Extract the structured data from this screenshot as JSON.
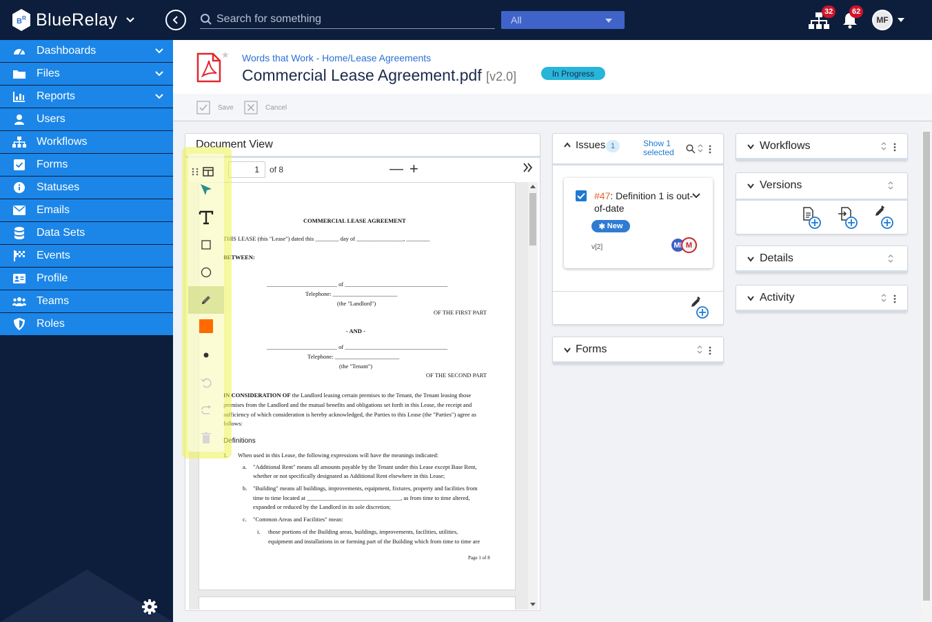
{
  "app": {
    "name": "BlueRelay"
  },
  "search": {
    "placeholder": "Search for something",
    "scope": "All"
  },
  "notifications": {
    "org_count": "32",
    "bell_count": "62"
  },
  "user": {
    "initials": "MF"
  },
  "sidebar": {
    "items": [
      {
        "label": "Dashboards",
        "icon": "dashboard-icon",
        "expandable": true
      },
      {
        "label": "Files",
        "icon": "folder-icon",
        "expandable": true
      },
      {
        "label": "Reports",
        "icon": "chart-icon",
        "expandable": true
      },
      {
        "label": "Users",
        "icon": "user-icon",
        "expandable": false
      },
      {
        "label": "Workflows",
        "icon": "sitemap-icon",
        "expandable": false
      },
      {
        "label": "Forms",
        "icon": "checkbox-icon",
        "expandable": false
      },
      {
        "label": "Statuses",
        "icon": "info-icon",
        "expandable": false
      },
      {
        "label": "Emails",
        "icon": "envelope-icon",
        "expandable": false
      },
      {
        "label": "Data Sets",
        "icon": "database-icon",
        "expandable": false
      },
      {
        "label": "Events",
        "icon": "flag-icon",
        "expandable": false
      },
      {
        "label": "Profile",
        "icon": "id-card-icon",
        "expandable": false
      },
      {
        "label": "Teams",
        "icon": "users-icon",
        "expandable": false
      },
      {
        "label": "Roles",
        "icon": "shield-icon",
        "expandable": false
      }
    ]
  },
  "header": {
    "breadcrumb": "Words that Work - Home/Lease Agreements",
    "title": "Commercial Lease Agreement.pdf",
    "version": "[v2.0]",
    "status": "In Progress"
  },
  "toolbar": {
    "save_label": "Save",
    "cancel_label": "Cancel"
  },
  "document_view": {
    "title": "Document View",
    "page": "1",
    "page_of": "of 8",
    "content": {
      "heading": "COMMERCIAL LEASE AGREEMENT",
      "l1": "THIS LEASE (this \"Lease\") dated this ________ day of ________________, ________",
      "between": "BETWEEN:",
      "l_of1": "________________________ of ___________________________________",
      "l_tel1": "Telephone: ______________________",
      "l_landlord": "(the \"Landlord\")",
      "l_first": "OF THE FIRST PART",
      "l_and": "- AND -",
      "l_of2": "________________________ of ___________________________________",
      "l_tel2": "Telephone: ______________________",
      "l_tenant": "(the \"Tenant\")",
      "l_second": "OF THE SECOND PART",
      "c_bold": "IN CONSIDERATION OF",
      "c1": " the Landlord leasing certain premises to the Tenant, the Tenant leasing those",
      "c2": "premises from the Landlord and the mutual benefits and obligations set forth in this Lease, the receipt and",
      "c3": "sufficiency of which consideration is hereby acknowledged, the Parties to this Lease (the \"Parties\") agree as",
      "c4": "follows:",
      "defs": "Definitions",
      "d1_num": "1.",
      "d1": "When used in this Lease, the following expressions will have the meanings indicated:",
      "da_num": "a.",
      "da1": "\"Additional Rent\" means all amounts payable by the Tenant under this Lease except Base Rent,",
      "da2": "whether or not specifically designated as Additional Rent elsewhere in this Lease;",
      "db_num": "b.",
      "db1": "\"Building\" means all buildings, improvements, equipment, fixtures, property and facilities from",
      "db2": "time to time located at ________________________________, as from time to time altered,",
      "db3": "expanded or reduced by the Landlord in its sole discretion;",
      "dc_num": "c.",
      "dc1": "\"Common Areas and Facilities\" mean:",
      "di_num": "i.",
      "di1": "those portions of the Building areas, buildings, improvements, facilities, utilities,",
      "di2": "equipment and installations in or forming part of the Building which from time to time are",
      "footer": "Page 1 of 8"
    }
  },
  "annotation_tools": [
    "grip-icon",
    "layout-icon",
    "pointer-icon",
    "text-icon",
    "rectangle-icon",
    "circle-icon",
    "pencil-icon",
    "color-swatch-icon",
    "dot-icon",
    "undo-icon",
    "redo-icon",
    "trash-icon"
  ],
  "colors": {
    "accent": "#1b86e8",
    "navy": "#0d1e3d",
    "swatch": "#ff6a00",
    "issue_number": "#e8602c"
  },
  "issues": {
    "title": "Issues",
    "count": "1",
    "show_selected": [
      "Show 1",
      "selected"
    ],
    "card": {
      "number": "#47",
      "title_rest": ": Definition 1 is out-of-date",
      "status": "New",
      "version": "v[2]",
      "avatars": [
        "MI",
        "M"
      ]
    }
  },
  "forms_panel": {
    "title": "Forms"
  },
  "right_panels": [
    {
      "title": "Workflows"
    },
    {
      "title": "Versions"
    },
    {
      "title": "Details"
    },
    {
      "title": "Activity"
    }
  ]
}
